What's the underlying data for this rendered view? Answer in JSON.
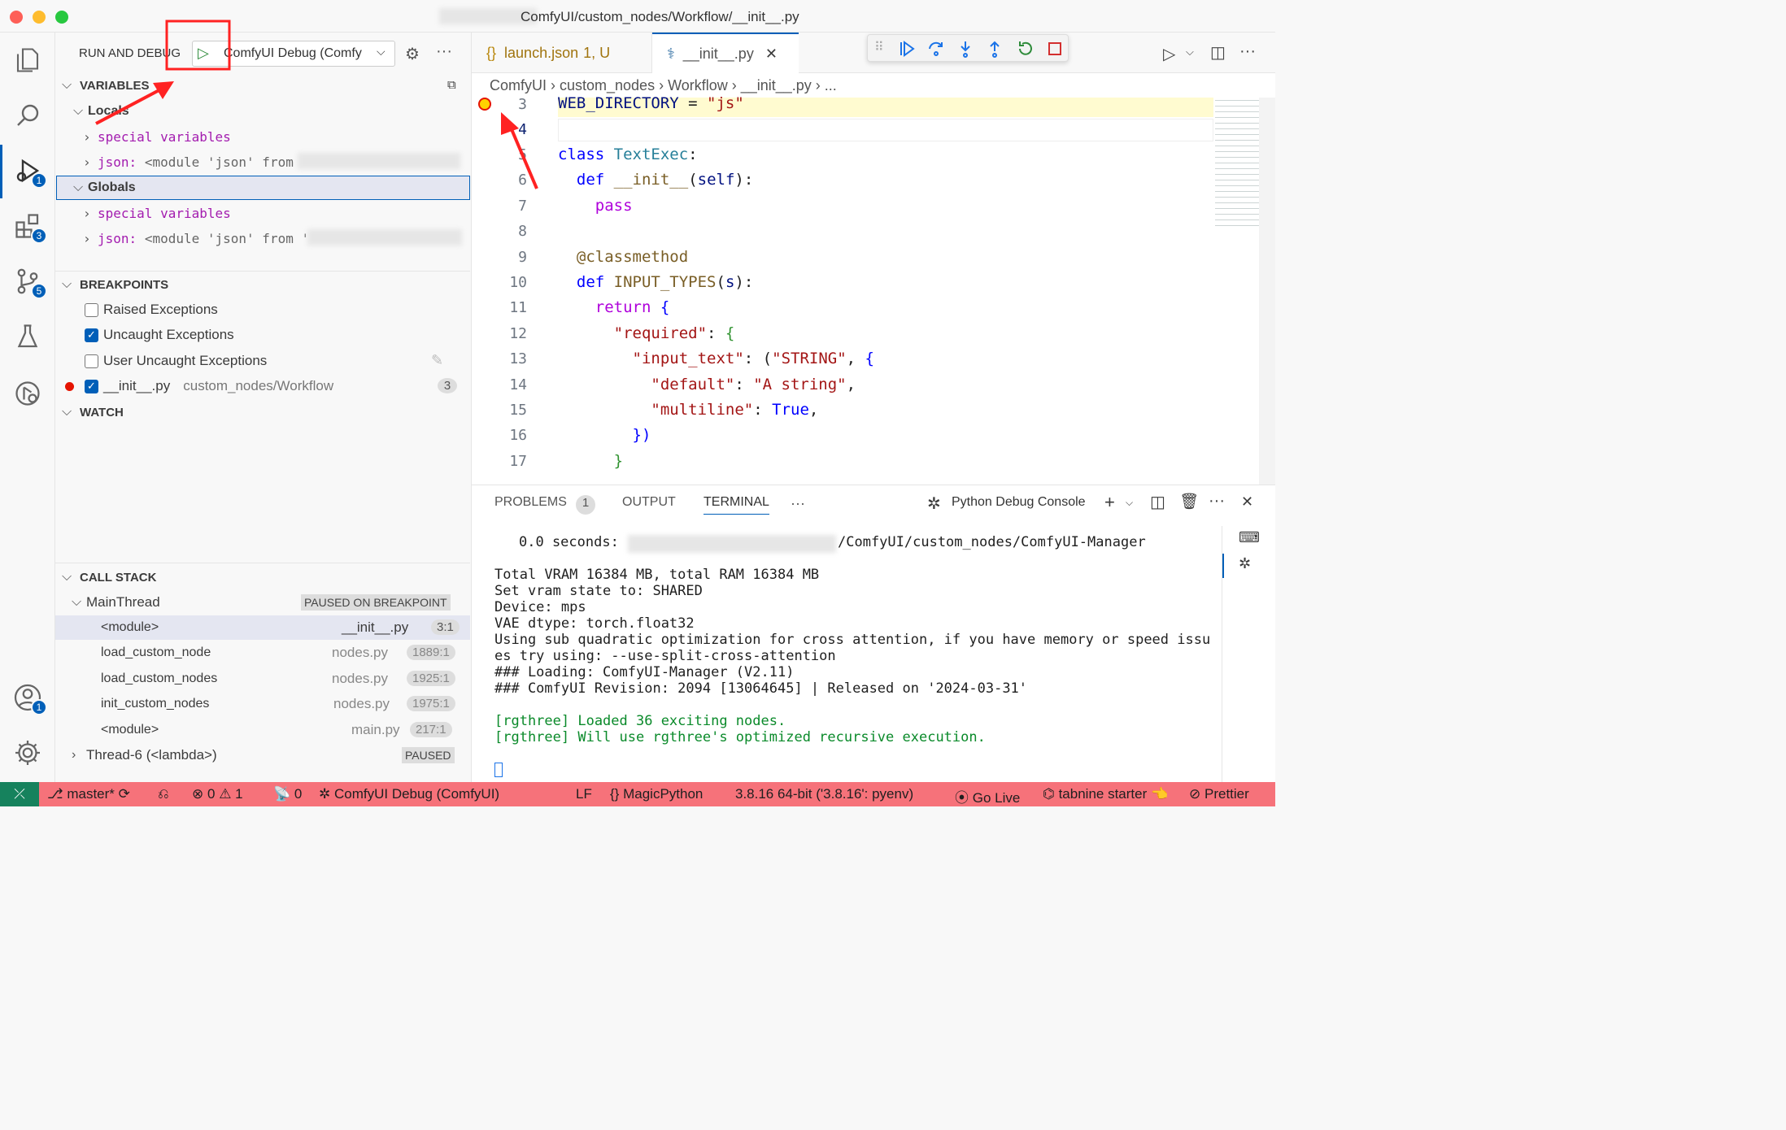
{
  "window": {
    "title": "ComfyUI/custom_nodes/Workflow/__init__.py"
  },
  "activity": {
    "items": [
      {
        "name": "explorer-icon",
        "badge": ""
      },
      {
        "name": "search-icon",
        "badge": ""
      },
      {
        "name": "run-debug-icon",
        "badge": "1"
      },
      {
        "name": "extensions-icon",
        "badge": "3"
      },
      {
        "name": "source-control-icon",
        "badge": "5"
      },
      {
        "name": "testing-icon",
        "badge": ""
      },
      {
        "name": "remote-explorer-icon",
        "badge": ""
      }
    ],
    "account_badge": "1"
  },
  "run": {
    "header": "RUN AND DEBUG",
    "config": "ComfyUI Debug (Comfy"
  },
  "variables": {
    "header": "VARIABLES",
    "locals": "Locals",
    "globals": "Globals",
    "items": {
      "special": "special variables",
      "json_name": "json:",
      "json_value": "<module 'json' from",
      "json_value2": "<module 'json' from '"
    }
  },
  "breakpoints": {
    "header": "BREAKPOINTS",
    "raised": "Raised Exceptions",
    "uncaught": "Uncaught Exceptions",
    "user_uncaught": "User Uncaught Exceptions",
    "file": "__init__.py",
    "path": "custom_nodes/Workflow",
    "line": "3"
  },
  "watch": {
    "header": "WATCH"
  },
  "callstack": {
    "header": "CALL STACK",
    "thread": "MainThread",
    "status": "PAUSED ON BREAKPOINT",
    "frames": [
      {
        "name": "<module>",
        "file": "__init__.py",
        "pos": "3:1"
      },
      {
        "name": "load_custom_node",
        "file": "nodes.py",
        "pos": "1889:1"
      },
      {
        "name": "load_custom_nodes",
        "file": "nodes.py",
        "pos": "1925:1"
      },
      {
        "name": "init_custom_nodes",
        "file": "nodes.py",
        "pos": "1975:1"
      },
      {
        "name": "<module>",
        "file": "main.py",
        "pos": "217:1"
      }
    ],
    "thread2": "Thread-6 (<lambda>)",
    "thread2_status": "PAUSED"
  },
  "tabs": {
    "launch": "launch.json",
    "launch_meta": "1, U",
    "init": "__init__.py"
  },
  "breadcrumb": "ComfyUI › custom_nodes › Workflow › __init__.py › ...",
  "code": {
    "lines": [
      "3",
      "4",
      "5",
      "6",
      "7",
      "8",
      "9",
      "10",
      "11",
      "12",
      "13",
      "14",
      "15",
      "16",
      "17"
    ]
  },
  "panel": {
    "problems": "PROBLEMS",
    "problems_count": "1",
    "output": "OUTPUT",
    "terminal": "TERMINAL",
    "console": "Python Debug Console"
  },
  "terminal": {
    "lines": [
      "0.0 seconds:",
      "/ComfyUI/custom_nodes/ComfyUI-Manager",
      "Total VRAM 16384 MB, total RAM 16384 MB",
      "Set vram state to: SHARED",
      "Device: mps",
      "VAE dtype: torch.float32",
      "Using sub quadratic optimization for cross attention, if you have memory or speed issu",
      "es try using: --use-split-cross-attention",
      "### Loading: ComfyUI-Manager (V2.11)",
      "### ComfyUI Revision: 2094 [13064645] | Released on '2024-03-31'",
      "[rgthree] Loaded 36 exciting nodes.",
      "[rgthree] Will use rgthree's optimized recursive execution."
    ]
  },
  "status": {
    "branch": "master*",
    "errors": "0",
    "warnings": "1",
    "ports": "0",
    "debug": "ComfyUI Debug (ComfyUI)",
    "eol": "LF",
    "lang": "MagicPython",
    "python": "3.8.16 64-bit ('3.8.16': pyenv)",
    "golive": "Go Live",
    "tabnine": "tabnine starter",
    "prettier": "Prettier"
  },
  "colors": {
    "status_bg": "#f6727a",
    "accent": "#005fb8",
    "annotation": "#ff2222"
  }
}
